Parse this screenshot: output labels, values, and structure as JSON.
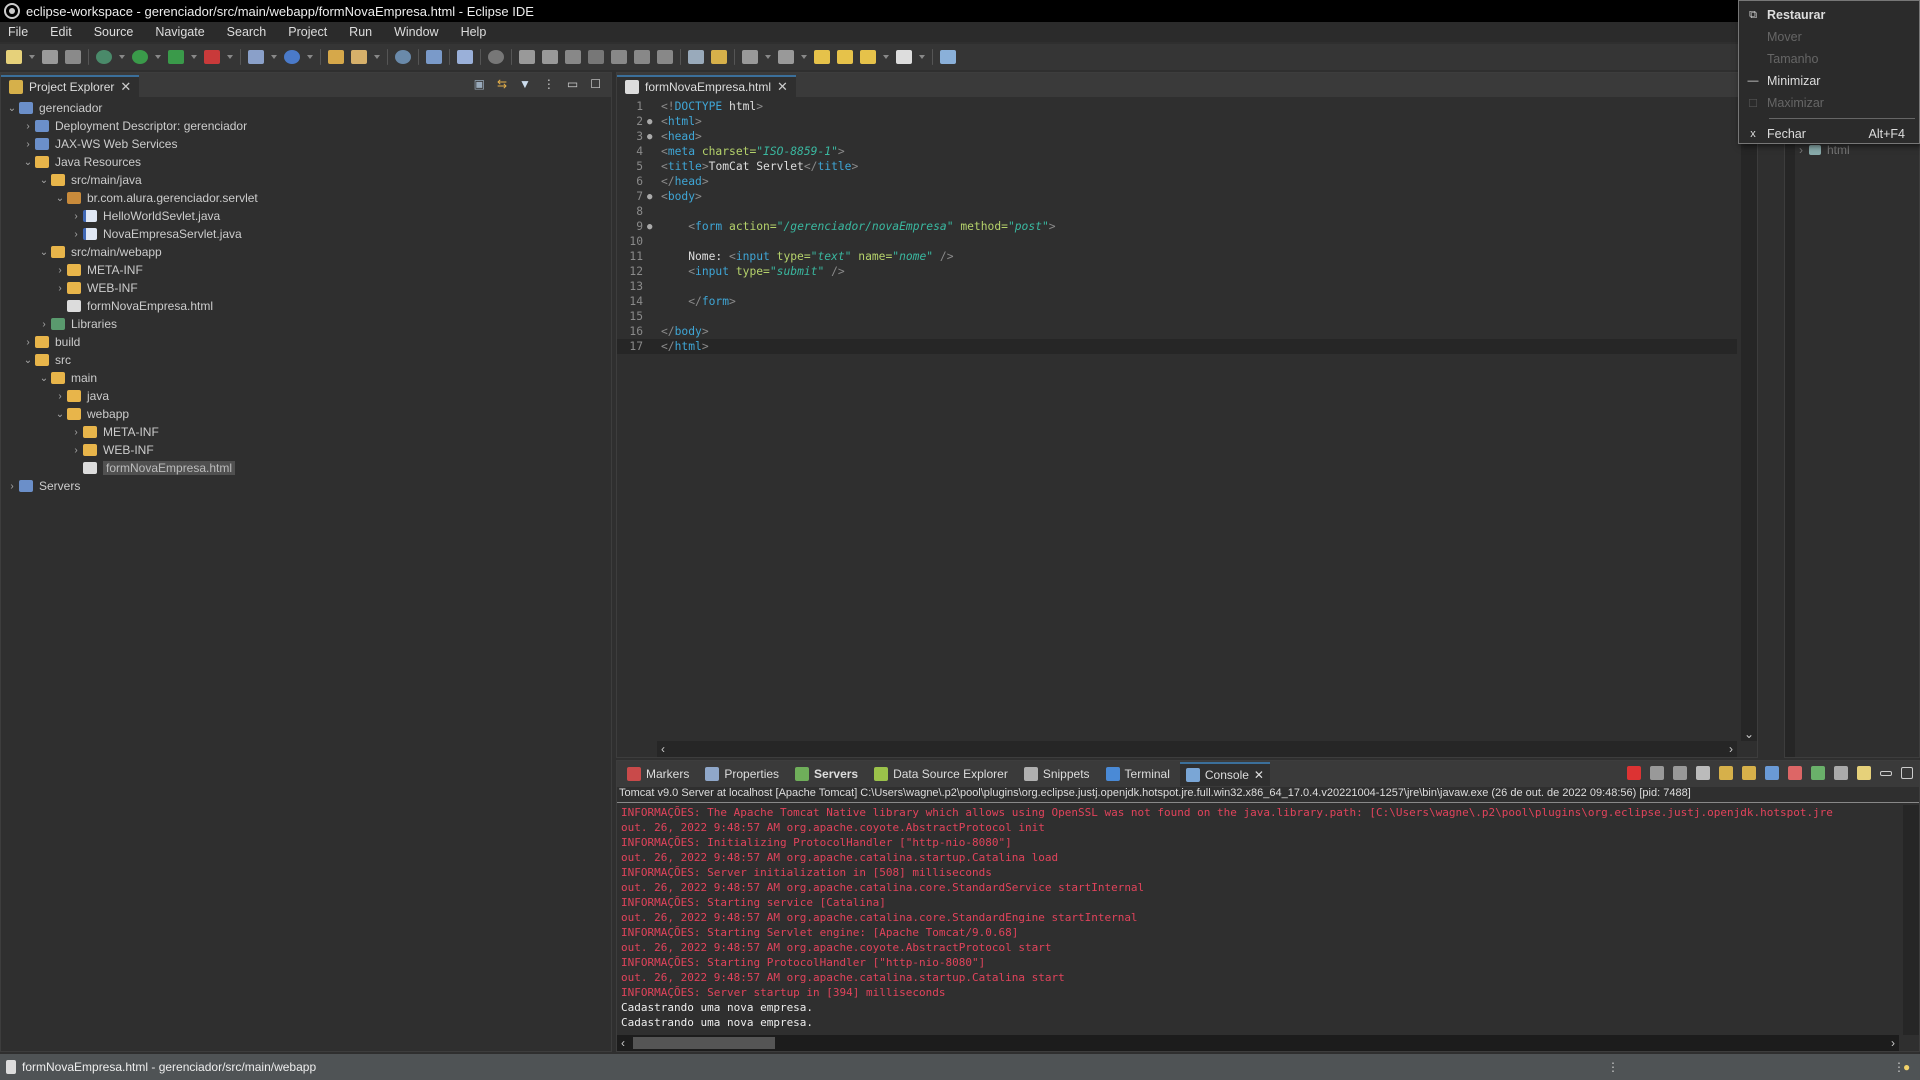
{
  "window": {
    "title": "eclipse-workspace - gerenciador/src/main/webapp/formNovaEmpresa.html - Eclipse IDE",
    "app_icon": "eclipse-icon"
  },
  "menubar": [
    "File",
    "Edit",
    "Source",
    "Navigate",
    "Search",
    "Project",
    "Run",
    "Window",
    "Help"
  ],
  "system_menu": {
    "items": [
      {
        "icon": "restore-icon",
        "label": "Restaurar",
        "enabled": true,
        "bold": true,
        "shortcut": ""
      },
      {
        "icon": "",
        "label": "Mover",
        "enabled": false,
        "bold": false,
        "shortcut": ""
      },
      {
        "icon": "",
        "label": "Tamanho",
        "enabled": false,
        "bold": false,
        "shortcut": ""
      },
      {
        "icon": "minimize-icon",
        "label": "Minimizar",
        "enabled": true,
        "bold": false,
        "shortcut": ""
      },
      {
        "icon": "maximize-icon",
        "label": "Maximizar",
        "enabled": false,
        "bold": false,
        "shortcut": ""
      },
      {
        "icon": "close-icon",
        "label": "Fechar",
        "enabled": true,
        "bold": false,
        "shortcut": "Alt+F4"
      }
    ]
  },
  "project_explorer": {
    "tab_label": "Project Explorer",
    "tree": [
      {
        "depth": 0,
        "arrow": "open",
        "icon": "proj",
        "label": "gerenciador"
      },
      {
        "depth": 1,
        "arrow": "closed",
        "icon": "proj",
        "label": "Deployment Descriptor: gerenciador"
      },
      {
        "depth": 1,
        "arrow": "closed",
        "icon": "proj",
        "label": "JAX-WS Web Services"
      },
      {
        "depth": 1,
        "arrow": "open",
        "icon": "folder",
        "label": "Java Resources"
      },
      {
        "depth": 2,
        "arrow": "open",
        "icon": "folder",
        "label": "src/main/java"
      },
      {
        "depth": 3,
        "arrow": "open",
        "icon": "pkg",
        "label": "br.com.alura.gerenciador.servlet"
      },
      {
        "depth": 4,
        "arrow": "closed",
        "icon": "java",
        "label": "HelloWorldSevlet.java"
      },
      {
        "depth": 4,
        "arrow": "closed",
        "icon": "java",
        "label": "NovaEmpresaServlet.java"
      },
      {
        "depth": 2,
        "arrow": "open",
        "icon": "folder",
        "label": "src/main/webapp"
      },
      {
        "depth": 3,
        "arrow": "closed",
        "icon": "folder",
        "label": "META-INF"
      },
      {
        "depth": 3,
        "arrow": "closed",
        "icon": "folder",
        "label": "WEB-INF"
      },
      {
        "depth": 3,
        "arrow": "none",
        "icon": "file",
        "label": "formNovaEmpresa.html"
      },
      {
        "depth": 2,
        "arrow": "closed",
        "icon": "lib",
        "label": "Libraries"
      },
      {
        "depth": 1,
        "arrow": "closed",
        "icon": "folder",
        "label": "build"
      },
      {
        "depth": 1,
        "arrow": "open",
        "icon": "folder",
        "label": "src"
      },
      {
        "depth": 2,
        "arrow": "open",
        "icon": "folder",
        "label": "main"
      },
      {
        "depth": 3,
        "arrow": "closed",
        "icon": "folder",
        "label": "java"
      },
      {
        "depth": 3,
        "arrow": "open",
        "icon": "folder",
        "label": "webapp"
      },
      {
        "depth": 4,
        "arrow": "closed",
        "icon": "folder",
        "label": "META-INF"
      },
      {
        "depth": 4,
        "arrow": "closed",
        "icon": "folder",
        "label": "WEB-INF"
      },
      {
        "depth": 4,
        "arrow": "none",
        "icon": "file",
        "label": "formNovaEmpresa.html",
        "selected": true
      },
      {
        "depth": 0,
        "arrow": "closed",
        "icon": "proj",
        "label": "Servers"
      }
    ]
  },
  "editor": {
    "tab_label": "formNovaEmpresa.html",
    "lines": [
      {
        "n": "1",
        "fold": "",
        "tokens": [
          [
            "bracket",
            "<!"
          ],
          [
            "doc",
            "DOCTYPE"
          ],
          [
            "plain",
            " html"
          ],
          [
            "bracket",
            ">"
          ]
        ]
      },
      {
        "n": "2",
        "fold": "●",
        "tokens": [
          [
            "bracket",
            "<"
          ],
          [
            "tag",
            "html"
          ],
          [
            "bracket",
            ">"
          ]
        ]
      },
      {
        "n": "3",
        "fold": "●",
        "tokens": [
          [
            "bracket",
            "<"
          ],
          [
            "tag",
            "head"
          ],
          [
            "bracket",
            ">"
          ]
        ]
      },
      {
        "n": "4",
        "fold": "",
        "tokens": [
          [
            "bracket",
            "<"
          ],
          [
            "tag",
            "meta"
          ],
          [
            "attr",
            " charset="
          ],
          [
            "val",
            "\"ISO-8859-1\""
          ],
          [
            "bracket",
            ">"
          ]
        ]
      },
      {
        "n": "5",
        "fold": "",
        "tokens": [
          [
            "bracket",
            "<"
          ],
          [
            "tag",
            "title"
          ],
          [
            "bracket",
            ">"
          ],
          [
            "plain",
            "TomCat Servlet"
          ],
          [
            "bracket",
            "</"
          ],
          [
            "tag",
            "title"
          ],
          [
            "bracket",
            ">"
          ]
        ]
      },
      {
        "n": "6",
        "fold": "",
        "tokens": [
          [
            "bracket",
            "</"
          ],
          [
            "tag",
            "head"
          ],
          [
            "bracket",
            ">"
          ]
        ]
      },
      {
        "n": "7",
        "fold": "●",
        "tokens": [
          [
            "bracket",
            "<"
          ],
          [
            "tag",
            "body"
          ],
          [
            "bracket",
            ">"
          ]
        ]
      },
      {
        "n": "8",
        "fold": "",
        "tokens": []
      },
      {
        "n": "9",
        "fold": "●",
        "tokens": [
          [
            "plain",
            "    "
          ],
          [
            "bracket",
            "<"
          ],
          [
            "tag",
            "form"
          ],
          [
            "attr",
            " action="
          ],
          [
            "val",
            "\"/gerenciador/novaEmpresa\""
          ],
          [
            "attr",
            " method="
          ],
          [
            "val",
            "\"post\""
          ],
          [
            "bracket",
            ">"
          ]
        ]
      },
      {
        "n": "10",
        "fold": "",
        "tokens": []
      },
      {
        "n": "11",
        "fold": "",
        "tokens": [
          [
            "plain",
            "    Nome: "
          ],
          [
            "bracket",
            "<"
          ],
          [
            "tag",
            "input"
          ],
          [
            "attr",
            " type="
          ],
          [
            "val",
            "\"text\""
          ],
          [
            "attr",
            " name="
          ],
          [
            "val",
            "\"nome\""
          ],
          [
            "bracket",
            " />"
          ]
        ]
      },
      {
        "n": "12",
        "fold": "",
        "tokens": [
          [
            "plain",
            "    "
          ],
          [
            "bracket",
            "<"
          ],
          [
            "tag",
            "input"
          ],
          [
            "attr",
            " type="
          ],
          [
            "val",
            "\"submit\""
          ],
          [
            "bracket",
            " />"
          ]
        ]
      },
      {
        "n": "13",
        "fold": "",
        "tokens": []
      },
      {
        "n": "14",
        "fold": "",
        "tokens": [
          [
            "plain",
            "    "
          ],
          [
            "bracket",
            "</"
          ],
          [
            "tag",
            "form"
          ],
          [
            "bracket",
            ">"
          ]
        ]
      },
      {
        "n": "15",
        "fold": "",
        "tokens": []
      },
      {
        "n": "16",
        "fold": "",
        "tokens": [
          [
            "bracket",
            "</"
          ],
          [
            "tag",
            "body"
          ],
          [
            "bracket",
            ">"
          ]
        ]
      },
      {
        "n": "17",
        "fold": "",
        "tokens": [
          [
            "bracket",
            "</"
          ],
          [
            "tag",
            "html"
          ],
          [
            "bracket",
            ">"
          ]
        ],
        "current": true
      }
    ]
  },
  "outline": {
    "item": "html"
  },
  "console_panel": {
    "tabs": [
      {
        "label": "Markers",
        "icon": "markers-icon",
        "color": "#c94a4a"
      },
      {
        "label": "Properties",
        "icon": "properties-icon",
        "color": "#8fa7c9"
      },
      {
        "label": "Servers",
        "icon": "servers-icon",
        "color": "#6fae5a",
        "bold": true
      },
      {
        "label": "Data Source Explorer",
        "icon": "datasource-icon",
        "color": "#9bc24a"
      },
      {
        "label": "Snippets",
        "icon": "snippets-icon",
        "color": "#b0b0b0"
      },
      {
        "label": "Terminal",
        "icon": "terminal-icon",
        "color": "#4a8ad6"
      },
      {
        "label": "Console",
        "icon": "console-icon",
        "color": "#7aa6d6",
        "active": true
      }
    ],
    "description": "Tomcat v9.0 Server at localhost [Apache Tomcat] C:\\Users\\wagne\\.p2\\pool\\plugins\\org.eclipse.justj.openjdk.hotspot.jre.full.win32.x86_64_17.0.4.v20221004-1257\\jre\\bin\\javaw.exe  (26 de out. de 2022 09:48:56) [pid: 7488]",
    "log": [
      {
        "c": "red",
        "t": "INFORMAÇÕES: The Apache Tomcat Native library which allows using OpenSSL was not found on the java.library.path: [C:\\Users\\wagne\\.p2\\pool\\plugins\\org.eclipse.justj.openjdk.hotspot.jre"
      },
      {
        "c": "red",
        "t": "out. 26, 2022 9:48:57 AM org.apache.coyote.AbstractProtocol init"
      },
      {
        "c": "red",
        "t": "INFORMAÇÕES: Initializing ProtocolHandler [\"http-nio-8080\"]"
      },
      {
        "c": "red",
        "t": "out. 26, 2022 9:48:57 AM org.apache.catalina.startup.Catalina load"
      },
      {
        "c": "red",
        "t": "INFORMAÇÕES: Server initialization in [508] milliseconds"
      },
      {
        "c": "red",
        "t": "out. 26, 2022 9:48:57 AM org.apache.catalina.core.StandardService startInternal"
      },
      {
        "c": "red",
        "t": "INFORMAÇÕES: Starting service [Catalina]"
      },
      {
        "c": "red",
        "t": "out. 26, 2022 9:48:57 AM org.apache.catalina.core.StandardEngine startInternal"
      },
      {
        "c": "red",
        "t": "INFORMAÇÕES: Starting Servlet engine: [Apache Tomcat/9.0.68]"
      },
      {
        "c": "red",
        "t": "out. 26, 2022 9:48:57 AM org.apache.coyote.AbstractProtocol start"
      },
      {
        "c": "red",
        "t": "INFORMAÇÕES: Starting ProtocolHandler [\"http-nio-8080\"]"
      },
      {
        "c": "red",
        "t": "out. 26, 2022 9:48:57 AM org.apache.catalina.startup.Catalina start"
      },
      {
        "c": "red",
        "t": "INFORMAÇÕES: Server startup in [394] milliseconds"
      },
      {
        "c": "white",
        "t": "Cadastrando uma nova empresa."
      },
      {
        "c": "white",
        "t": "Cadastrando uma nova empresa."
      }
    ]
  },
  "statusbar": {
    "text": "formNovaEmpresa.html - gerenciador/src/main/webapp"
  }
}
